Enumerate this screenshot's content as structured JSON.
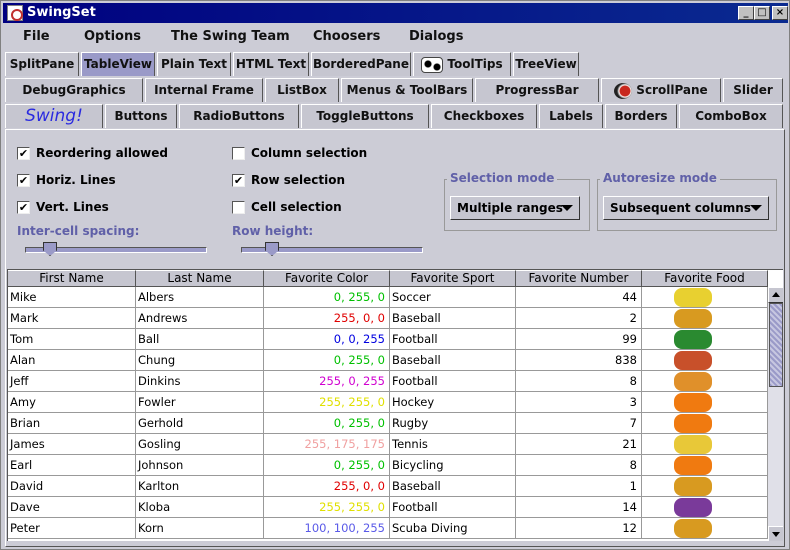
{
  "window": {
    "title": "SwingSet"
  },
  "window_controls": {
    "minimize": "_",
    "maximize": "□",
    "close": "×"
  },
  "menubar": [
    "File",
    "Options",
    "The Swing Team",
    "Choosers",
    "Dialogs"
  ],
  "tabs": {
    "row1": [
      {
        "label": "SplitPane",
        "selected": false
      },
      {
        "label": "TableView",
        "selected": true
      },
      {
        "label": "Plain Text",
        "selected": false
      },
      {
        "label": "HTML Text",
        "selected": false
      },
      {
        "label": "BorderedPane",
        "selected": false
      },
      {
        "label": "ToolTips",
        "selected": false,
        "icon": "cow-icon"
      },
      {
        "label": "TreeView",
        "selected": false
      }
    ],
    "row2": [
      {
        "label": "DebugGraphics"
      },
      {
        "label": "Internal Frame"
      },
      {
        "label": "ListBox"
      },
      {
        "label": "Menus & ToolBars"
      },
      {
        "label": "ProgressBar"
      },
      {
        "label": "ScrollPane",
        "icon": "duke-icon"
      },
      {
        "label": "Slider"
      }
    ],
    "row3": [
      {
        "label": "Swing!"
      },
      {
        "label": "Buttons"
      },
      {
        "label": "RadioButtons"
      },
      {
        "label": "ToggleButtons"
      },
      {
        "label": "Checkboxes"
      },
      {
        "label": "Labels"
      },
      {
        "label": "Borders"
      },
      {
        "label": "ComboBox"
      }
    ]
  },
  "controls": {
    "reordering": {
      "label": "Reordering allowed",
      "checked": true
    },
    "horiz_lines": {
      "label": "Horiz. Lines",
      "checked": true
    },
    "vert_lines": {
      "label": "Vert. Lines",
      "checked": true
    },
    "column_selection": {
      "label": "Column selection",
      "checked": false
    },
    "row_selection": {
      "label": "Row selection",
      "checked": true
    },
    "cell_selection": {
      "label": "Cell selection",
      "checked": false
    },
    "check_mark": "✔",
    "intercell_label": "Inter-cell spacing:",
    "intercell_value": 0.1,
    "rowheight_label": "Row height:",
    "rowheight_value": 0.14,
    "selection_mode": {
      "title": "Selection mode",
      "value": "Multiple ranges"
    },
    "autoresize_mode": {
      "title": "Autoresize mode",
      "value": "Subsequent columns"
    }
  },
  "table": {
    "columns": [
      "First Name",
      "Last Name",
      "Favorite Color",
      "Favorite Sport",
      "Favorite Number",
      "Favorite Food"
    ],
    "rows": [
      {
        "first": "Mike",
        "last": "Albers",
        "color": "0, 255, 0",
        "color_hex": "#00c000",
        "sport": "Soccer",
        "number": "44",
        "food": "banana-icon"
      },
      {
        "first": "Mark",
        "last": "Andrews",
        "color": "255, 0, 0",
        "color_hex": "#e00000",
        "sport": "Baseball",
        "number": "2",
        "food": "corn-icon"
      },
      {
        "first": "Tom",
        "last": "Ball",
        "color": "0, 0, 255",
        "color_hex": "#0000e0",
        "sport": "Football",
        "number": "99",
        "food": "peppers-icon"
      },
      {
        "first": "Alan",
        "last": "Chung",
        "color": "0, 255, 0",
        "color_hex": "#00c000",
        "sport": "Baseball",
        "number": "838",
        "food": "hotdog-icon"
      },
      {
        "first": "Jeff",
        "last": "Dinkins",
        "color": "255, 0, 255",
        "color_hex": "#d000d0",
        "sport": "Football",
        "number": "8",
        "food": "cantaloupe-icon"
      },
      {
        "first": "Amy",
        "last": "Fowler",
        "color": "255, 255, 0",
        "color_hex": "#e0e000",
        "sport": "Hockey",
        "number": "3",
        "food": "carrot-icon"
      },
      {
        "first": "Brian",
        "last": "Gerhold",
        "color": "0, 255, 0",
        "color_hex": "#00c000",
        "sport": "Rugby",
        "number": "7",
        "food": "carrot-icon"
      },
      {
        "first": "James",
        "last": "Gosling",
        "color": "255, 175, 175",
        "color_hex": "#f0a0a0",
        "sport": "Tennis",
        "number": "21",
        "food": "donut-icon"
      },
      {
        "first": "Earl",
        "last": "Johnson",
        "color": "0, 255, 0",
        "color_hex": "#00c000",
        "sport": "Bicycling",
        "number": "8",
        "food": "carrot-icon"
      },
      {
        "first": "David",
        "last": "Karlton",
        "color": "255, 0, 0",
        "color_hex": "#e00000",
        "sport": "Baseball",
        "number": "1",
        "food": "corn-icon"
      },
      {
        "first": "Dave",
        "last": "Kloba",
        "color": "255, 255, 0",
        "color_hex": "#e0e000",
        "sport": "Football",
        "number": "14",
        "food": "grapes-icon"
      },
      {
        "first": "Peter",
        "last": "Korn",
        "color": "100, 100, 255",
        "color_hex": "#5a5ae8",
        "sport": "Scuba Diving",
        "number": "12",
        "food": "corn-icon"
      }
    ]
  },
  "colors": {
    "accent": "#9a9ac8",
    "titlebar": "#000080",
    "panel": "#ccccd6",
    "caption": "#6060a8"
  }
}
